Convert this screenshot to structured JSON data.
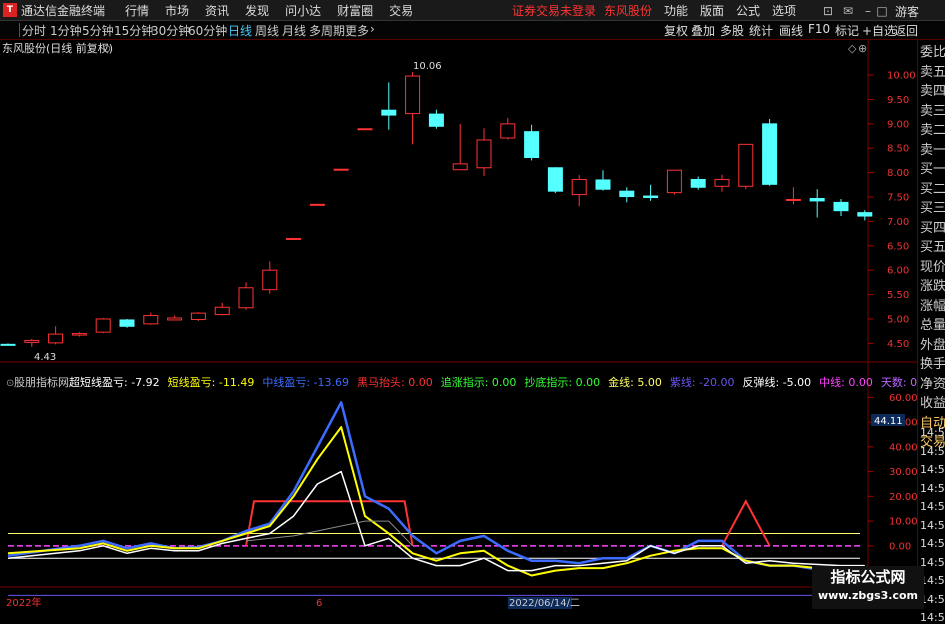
{
  "app": {
    "title": "通达信金融终端",
    "logo_text": "T"
  },
  "menu": [
    "行情",
    "市场",
    "资讯",
    "发现",
    "问小达",
    "财富圈",
    "交易"
  ],
  "status": {
    "login": "证券交易未登录",
    "stock": "东风股份"
  },
  "func_menu": [
    "功能",
    "版面",
    "公式",
    "选项"
  ],
  "guest": "游客",
  "periods": [
    "分时",
    "1分钟",
    "5分钟",
    "15分钟",
    "30分钟",
    "60分钟",
    "日线",
    "周线",
    "月线",
    "多周期",
    "更多"
  ],
  "active_period": "日线",
  "tools": [
    "复权",
    "叠加",
    "多股",
    "统计",
    "画线",
    "F10",
    "标记",
    "+自选",
    "返回"
  ],
  "right_panel": [
    "委比",
    "卖五",
    "卖四",
    "卖三",
    "卖二",
    "卖一",
    "买一",
    "买二",
    "买三",
    "买四",
    "买五",
    "现价",
    "涨跌",
    "涨幅",
    "总量",
    "外盘",
    "换手",
    "净资",
    "收益",
    "自动",
    "交易"
  ],
  "right_axis_times": [
    "14:56",
    "14:56",
    "14:56",
    "14:56",
    "14:56",
    "14:56",
    "14:56",
    "14:56",
    "14:56",
    "14:56",
    "14:56"
  ],
  "price_panel": {
    "title": "东风股份(日线 前复权)",
    "mark_high": "10.06",
    "mark_low": "4.43"
  },
  "indicator_panel": {
    "name": "股朋指标网",
    "items": [
      {
        "label": "超短线盈亏:",
        "value": "-7.92",
        "color": "#ffffff"
      },
      {
        "label": "短线盈亏:",
        "value": "-11.49",
        "color": "#ffff00"
      },
      {
        "label": "中线盈亏:",
        "value": "-13.69",
        "color": "#3c6cff"
      },
      {
        "label": "黑马抬头:",
        "value": "0.00",
        "color": "#ff3333"
      },
      {
        "label": "追涨指示:",
        "value": "0.00",
        "color": "#33ff33"
      },
      {
        "label": "抄底指示:",
        "value": "0.00",
        "color": "#33ff33"
      },
      {
        "label": "金线:",
        "value": "5.00",
        "color": "#ffff66"
      },
      {
        "label": "紫线:",
        "value": "-20.00",
        "color": "#6655ee"
      },
      {
        "label": "反弹线:",
        "value": "-5.00",
        "color": "#ffffff"
      },
      {
        "label": "中线:",
        "value": "0.00",
        "color": "#ff44ff"
      },
      {
        "label": "天数:",
        "value": "0.00",
        "color": "#bb66ff"
      }
    ],
    "cursor_value": "44.11"
  },
  "bottom_axis": {
    "labels": [
      "2022年",
      "6",
      "2022/06/14/二"
    ]
  },
  "watermark": {
    "line1": "指标公式网",
    "line2": "www.zbgs3.com"
  },
  "chart_data": {
    "type": "candlestick",
    "price": {
      "ylim": [
        4.2,
        10.35
      ],
      "ticks": [
        4.5,
        5.0,
        5.5,
        6.0,
        6.5,
        7.0,
        7.5,
        8.0,
        8.5,
        9.0,
        9.5,
        10.0
      ],
      "candles": [
        [
          4.48,
          4.47,
          4.5,
          4.45
        ],
        [
          4.52,
          4.56,
          4.59,
          4.43
        ],
        [
          4.51,
          4.69,
          4.85,
          4.48
        ],
        [
          4.67,
          4.7,
          4.73,
          4.64
        ],
        [
          4.73,
          5.0,
          5.02,
          4.71
        ],
        [
          4.98,
          4.85,
          5.0,
          4.82
        ],
        [
          4.9,
          5.07,
          5.13,
          4.88
        ],
        [
          4.98,
          5.02,
          5.07,
          4.97
        ],
        [
          4.99,
          5.12,
          5.14,
          4.96
        ],
        [
          5.09,
          5.24,
          5.33,
          5.07
        ],
        [
          5.23,
          5.64,
          5.75,
          5.19
        ],
        [
          5.6,
          6.0,
          6.18,
          5.52
        ],
        [
          6.65,
          6.65,
          6.65,
          6.65
        ],
        [
          7.35,
          7.35,
          7.35,
          7.35
        ],
        [
          8.07,
          8.07,
          8.07,
          8.07
        ],
        [
          8.9,
          8.9,
          8.9,
          8.9
        ],
        [
          9.28,
          9.18,
          9.85,
          8.88
        ],
        [
          9.21,
          9.98,
          10.06,
          8.58
        ],
        [
          9.2,
          8.95,
          9.29,
          8.9
        ],
        [
          8.06,
          8.18,
          9.0,
          8.07
        ],
        [
          8.1,
          8.67,
          8.91,
          7.93
        ],
        [
          8.71,
          9.0,
          9.12,
          8.68
        ],
        [
          8.84,
          8.31,
          8.98,
          8.25
        ],
        [
          8.1,
          7.62,
          8.11,
          7.58
        ],
        [
          7.55,
          7.86,
          7.95,
          7.31
        ],
        [
          7.85,
          7.66,
          8.05,
          7.63
        ],
        [
          7.62,
          7.51,
          7.7,
          7.39
        ],
        [
          7.52,
          7.49,
          7.75,
          7.42
        ],
        [
          7.59,
          8.05,
          8.06,
          7.55
        ],
        [
          7.86,
          7.7,
          7.92,
          7.65
        ],
        [
          7.72,
          7.86,
          7.96,
          7.61
        ],
        [
          7.72,
          8.58,
          8.58,
          7.66
        ],
        [
          9.0,
          7.76,
          9.1,
          7.73
        ],
        [
          7.43,
          7.45,
          7.7,
          7.35
        ],
        [
          7.47,
          7.42,
          7.66,
          7.08
        ],
        [
          7.39,
          7.22,
          7.46,
          7.11
        ],
        [
          7.18,
          7.11,
          7.23,
          7.02
        ]
      ]
    },
    "indicator": {
      "ylim": [
        -13,
        65
      ],
      "ticks": [
        0,
        10,
        20,
        30,
        40,
        50,
        60
      ],
      "h_lines": [
        {
          "value": 5,
          "color": "#ffff66"
        },
        {
          "value": 0,
          "color": "#ff44ff"
        },
        {
          "value": -5,
          "color": "#ffffff"
        },
        {
          "value": -20,
          "color": "#6655ee"
        }
      ],
      "series": [
        {
          "color": "#3c6cff",
          "width": 2.5,
          "values": [
            [
              0,
              -4
            ],
            [
              3,
              0
            ],
            [
              4,
              2
            ],
            [
              5,
              -1
            ],
            [
              6,
              1
            ],
            [
              7,
              -1
            ],
            [
              8,
              -0.5
            ],
            [
              9,
              2
            ],
            [
              10,
              6
            ],
            [
              11,
              9
            ],
            [
              12,
              22
            ],
            [
              13,
              40
            ],
            [
              14,
              58
            ],
            [
              15,
              20
            ],
            [
              16,
              15
            ],
            [
              17,
              4
            ],
            [
              18,
              -3
            ],
            [
              19,
              2
            ],
            [
              20,
              4
            ],
            [
              21,
              -2
            ],
            [
              22,
              -6
            ],
            [
              23,
              -6
            ],
            [
              24,
              -7
            ],
            [
              25,
              -5
            ],
            [
              26,
              -5
            ],
            [
              27,
              0
            ],
            [
              28,
              -3
            ],
            [
              29,
              2
            ],
            [
              30,
              2
            ],
            [
              31,
              -6
            ],
            [
              32,
              -8
            ],
            [
              33,
              -8
            ],
            [
              35,
              -11
            ],
            [
              36,
              -13.5
            ]
          ]
        },
        {
          "color": "#ffff00",
          "width": 2,
          "values": [
            [
              0,
              -3
            ],
            [
              3,
              -1
            ],
            [
              4,
              1
            ],
            [
              5,
              -2
            ],
            [
              6,
              0
            ],
            [
              7,
              -1
            ],
            [
              8,
              -1
            ],
            [
              9,
              2
            ],
            [
              10,
              5
            ],
            [
              11,
              8
            ],
            [
              12,
              20
            ],
            [
              13,
              35
            ],
            [
              14,
              48
            ],
            [
              15,
              12
            ],
            [
              16,
              5
            ],
            [
              17,
              -3
            ],
            [
              18,
              -6
            ],
            [
              19,
              -3
            ],
            [
              20,
              -2
            ],
            [
              21,
              -8
            ],
            [
              22,
              -12
            ],
            [
              23,
              -10
            ],
            [
              24,
              -9
            ],
            [
              25,
              -9
            ],
            [
              26,
              -7
            ],
            [
              27,
              -4
            ],
            [
              28,
              -2
            ],
            [
              29,
              -1
            ],
            [
              30,
              -1
            ],
            [
              31,
              -6
            ],
            [
              32,
              -8
            ],
            [
              33,
              -8
            ],
            [
              35,
              -10
            ],
            [
              36,
              -11.5
            ]
          ]
        },
        {
          "color": "#ffffff",
          "width": 1.5,
          "values": [
            [
              0,
              -5
            ],
            [
              3,
              -2
            ],
            [
              4,
              0
            ],
            [
              5,
              -3
            ],
            [
              6,
              -1
            ],
            [
              7,
              -2
            ],
            [
              8,
              -2
            ],
            [
              9,
              1
            ],
            [
              10,
              3
            ],
            [
              11,
              5
            ],
            [
              12,
              12
            ],
            [
              13,
              25
            ],
            [
              14,
              30
            ],
            [
              15,
              0
            ],
            [
              16,
              3
            ],
            [
              17,
              -5
            ],
            [
              18,
              -8
            ],
            [
              19,
              -8
            ],
            [
              20,
              -5
            ],
            [
              21,
              -10
            ],
            [
              22,
              -10
            ],
            [
              23,
              -8
            ],
            [
              24,
              -8
            ],
            [
              25,
              -7
            ],
            [
              26,
              -6
            ],
            [
              27,
              0
            ],
            [
              28,
              -3
            ],
            [
              29,
              0
            ],
            [
              30,
              0
            ],
            [
              31,
              -7
            ],
            [
              32,
              -6
            ],
            [
              33,
              -7
            ],
            [
              35,
              -8
            ],
            [
              36,
              -8
            ]
          ]
        },
        {
          "color": "#8a8a8a",
          "width": 1,
          "values": [
            [
              10,
              2
            ],
            [
              12,
              4
            ],
            [
              13,
              6
            ],
            [
              14,
              8
            ],
            [
              15,
              10
            ],
            [
              16,
              10
            ],
            [
              17,
              0
            ]
          ]
        }
      ],
      "step_lines": [
        {
          "color": "#ff3333",
          "x": [
            10,
            11,
            12,
            13,
            14,
            15,
            16,
            17
          ],
          "top": 18
        },
        {
          "color": "#ff3333",
          "x": [
            30,
            31,
            32
          ],
          "top": 18
        }
      ]
    }
  }
}
